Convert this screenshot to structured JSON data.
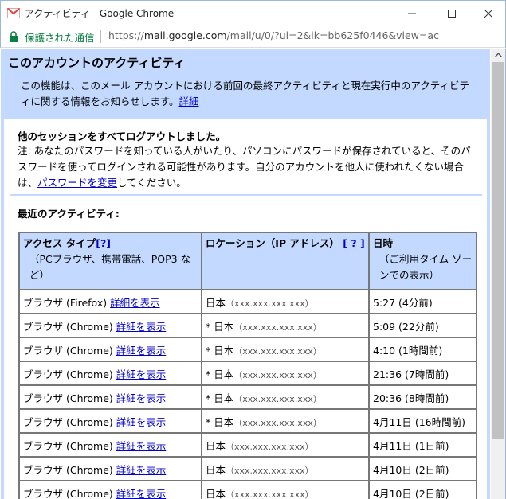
{
  "window": {
    "title": "アクティビティ - Google Chrome"
  },
  "address": {
    "secure_label": "保護された通信",
    "url_scheme": "https://",
    "url_host": "mail.google.com",
    "url_path": "/mail/u/0/?ui=2&ik=bb625f0446&view=ac"
  },
  "page": {
    "title": "このアカウントのアクティビティ",
    "intro_text": "この機能は、このメール アカウントにおける前回の最終アクティビティと現在実行中のアクティビティに関する情報をお知らせします。",
    "intro_link": "詳細",
    "notice_title": "他のセッションをすべてログアウトしました。",
    "notice_text_1": "注: あなたのパスワードを知っている人がいたり、パソコンにパスワードが保存されていると、そのパスワードを使ってログインされる可能性があります。自分のアカウントを他人に使われたくない場合は、",
    "notice_link": "パスワードを変更",
    "notice_text_2": "してください。",
    "recent_label": "最近のアクティビティ:"
  },
  "table": {
    "headers": {
      "access_type": "アクセス タイプ",
      "access_help": "[?]",
      "access_sub": "（PCブラウザ、携帯電話、POP3 など）",
      "location": "ロケーション（IP アドレス）",
      "location_help": "[ ? ]",
      "time": "日時",
      "time_sub": "（ご利用タイム ゾーンでの表示）"
    },
    "rows": [
      {
        "access": "ブラウザ (Firefox)",
        "link": "詳細を表示",
        "location": "日本",
        "ip": "（xxx.xxx.xxx.xxx）",
        "time": "5:27 (4分前)"
      },
      {
        "access": "ブラウザ (Chrome)",
        "link": "詳細を表示",
        "location": "* 日本",
        "ip": "（xxx.xxx.xxx.xxx）",
        "time": "5:09 (22分前)"
      },
      {
        "access": "ブラウザ (Chrome)",
        "link": "詳細を表示",
        "location": "* 日本",
        "ip": "（xxx.xxx.xxx.xxx）",
        "time": "4:10 (1時間前)"
      },
      {
        "access": "ブラウザ (Chrome)",
        "link": "詳細を表示",
        "location": "* 日本",
        "ip": "（xxx.xxx.xxx.xxx）",
        "time": "21:36 (7時間前)"
      },
      {
        "access": "ブラウザ (Chrome)",
        "link": "詳細を表示",
        "location": "* 日本",
        "ip": "（xxx.xxx.xxx.xxx）",
        "time": "20:36 (8時間前)"
      },
      {
        "access": "ブラウザ (Chrome)",
        "link": "詳細を表示",
        "location": "* 日本",
        "ip": "（xxx.xxx.xxx.xxx）",
        "time": "4月11日 (16時間前)"
      },
      {
        "access": "ブラウザ (Chrome)",
        "link": "詳細を表示",
        "location": "日本",
        "ip": "（xxx.xxx.xxx.xxx）",
        "time": "4月11日 (1日前)"
      },
      {
        "access": "ブラウザ (Chrome)",
        "link": "詳細を表示",
        "location": "日本",
        "ip": "（xxx.xxx.xxx.xxx）",
        "time": "4月10日 (2日前)"
      },
      {
        "access": "ブラウザ (Chrome)",
        "link": "詳細を表示",
        "location": "日本",
        "ip": "（xxx.xxx.xxx.xxx）",
        "time": "4月10日 (2日前)"
      }
    ]
  },
  "colors": {
    "header_bg": "#c3d9ff",
    "link": "#0000cc",
    "secure": "#0b8043"
  },
  "icons": {
    "app": "gmail-icon",
    "lock": "lock-icon",
    "minimize": "minimize-icon",
    "maximize": "maximize-icon",
    "close": "close-icon"
  }
}
